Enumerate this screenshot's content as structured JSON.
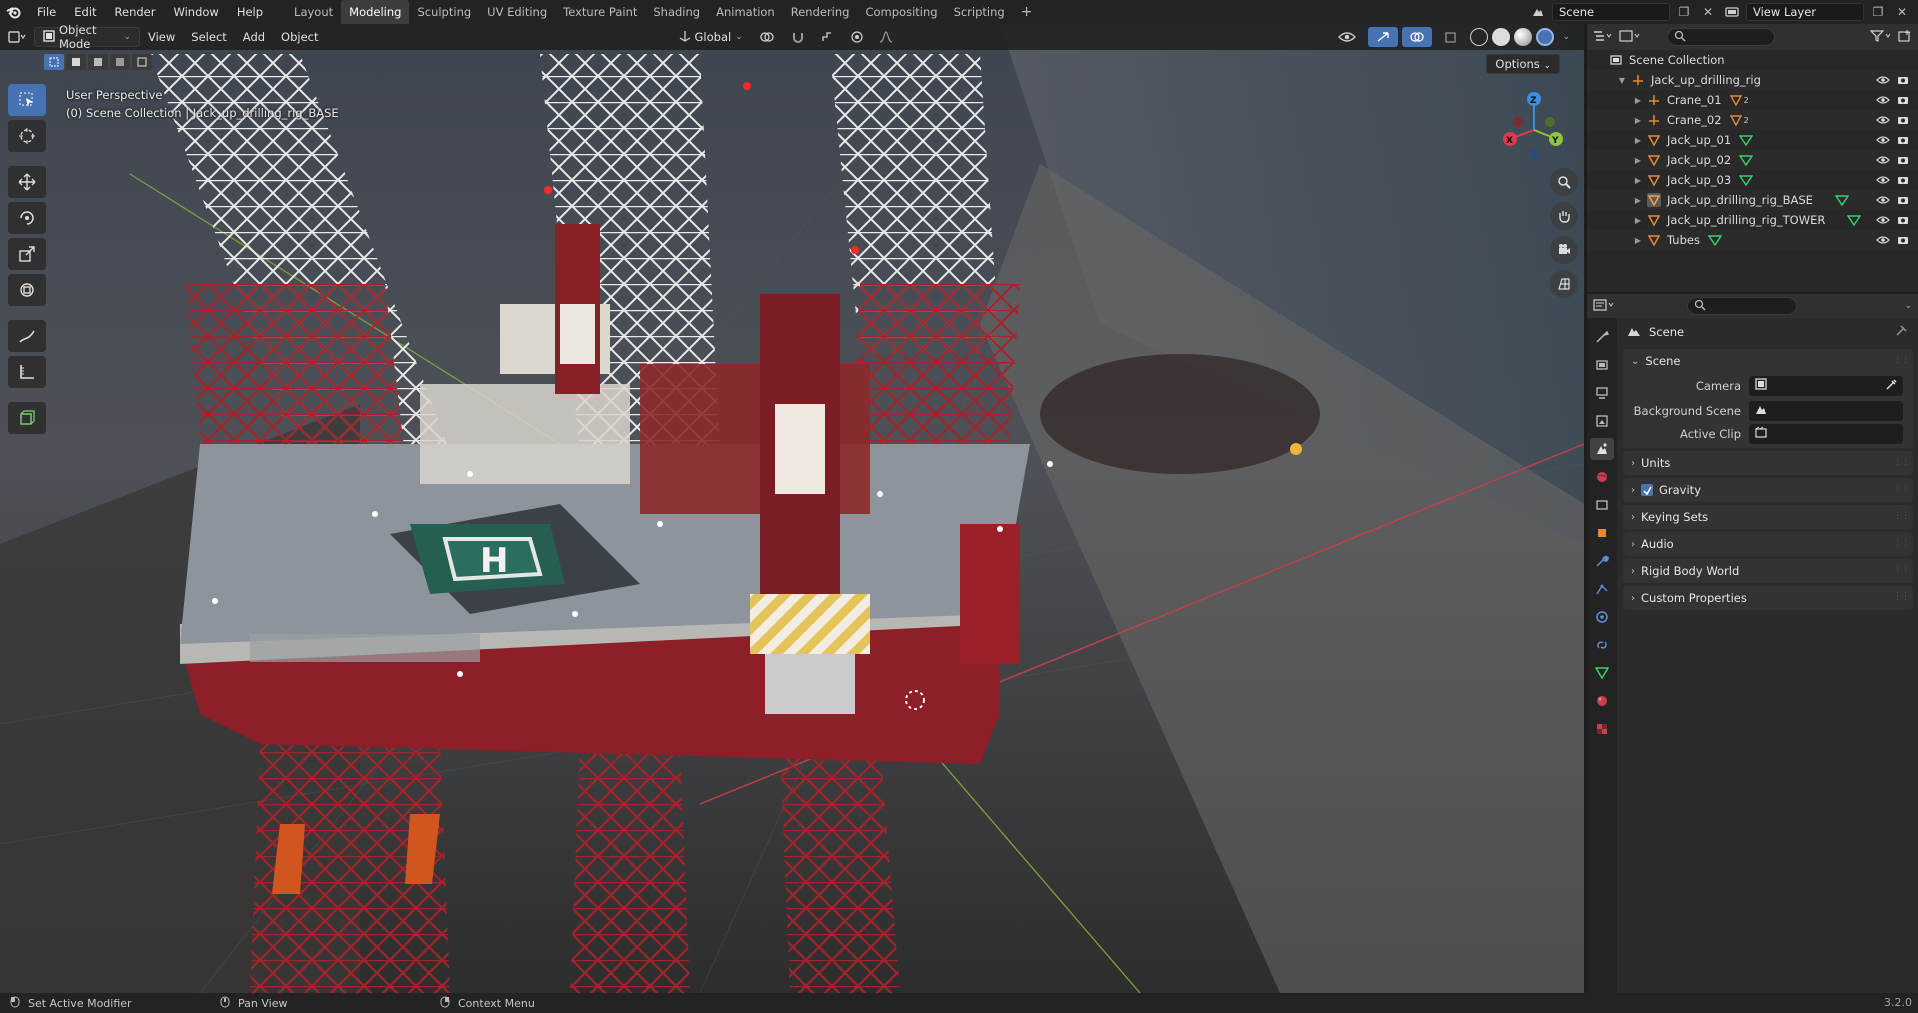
{
  "topbar": {
    "menus": [
      "File",
      "Edit",
      "Render",
      "Window",
      "Help"
    ],
    "workspaces": [
      "Layout",
      "Modeling",
      "Sculpting",
      "UV Editing",
      "Texture Paint",
      "Shading",
      "Animation",
      "Rendering",
      "Compositing",
      "Scripting"
    ],
    "active_workspace": "Modeling",
    "add_workspace": "+",
    "scene_name": "Scene",
    "view_layer": "View Layer"
  },
  "viewport": {
    "mode": "Object Mode",
    "menus": [
      "View",
      "Select",
      "Add",
      "Object"
    ],
    "transform_orientation": "Global",
    "options_label": "Options",
    "info_line1": "User Perspective",
    "info_line2": "(0) Scene Collection | Jack_up_drilling_rig_BASE",
    "gizmo": {
      "x": "X",
      "y": "Y",
      "z": "Z"
    }
  },
  "outliner": {
    "root": "Scene Collection",
    "collection": "Jack_up_drilling_rig",
    "items": [
      {
        "label": "Crane_01",
        "type": "empty",
        "badge": "2"
      },
      {
        "label": "Crane_02",
        "type": "empty",
        "badge": "2"
      },
      {
        "label": "Jack_up_01",
        "type": "mesh"
      },
      {
        "label": "Jack_up_02",
        "type": "mesh"
      },
      {
        "label": "Jack_up_03",
        "type": "mesh"
      },
      {
        "label": "Jack_up_drilling_rig_BASE",
        "type": "mesh"
      },
      {
        "label": "Jack_up_drilling_rig_TOWER",
        "type": "mesh"
      },
      {
        "label": "Tubes",
        "type": "mesh"
      }
    ]
  },
  "properties": {
    "context_title": "Scene",
    "panel_scene": "Scene",
    "camera_label": "Camera",
    "background_scene_label": "Background Scene",
    "active_clip_label": "Active Clip",
    "panels": [
      "Units",
      "Gravity",
      "Keying Sets",
      "Audio",
      "Rigid Body World",
      "Custom Properties"
    ],
    "gravity_checked": true
  },
  "statusbar": {
    "left": "Set Active Modifier",
    "middle": "Pan View",
    "right": "Context Menu",
    "version": "3.2.0"
  },
  "colors": {
    "accent": "#4772b3",
    "axis_x": "#e0384e",
    "axis_y": "#8bc83b",
    "axis_z": "#3b8fe0",
    "mesh_icon": "#e08b3a",
    "vertex_icon": "#35d16b"
  }
}
